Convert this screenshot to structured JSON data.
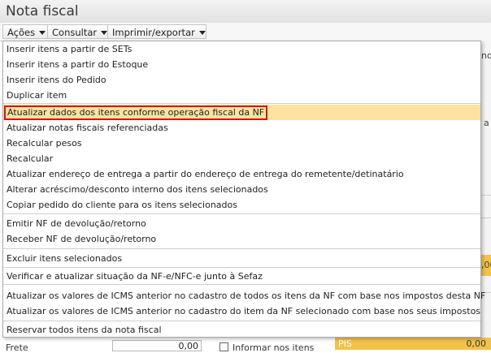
{
  "window": {
    "title": "Nota fiscal"
  },
  "toolbar": {
    "acoes": "Ações",
    "consultar": "Consultar",
    "imprimir": "Imprimir/exportar"
  },
  "menu": {
    "items": [
      "Inserir itens a partir de SETs",
      "Inserir itens a partir do Estoque",
      "Inserir itens do Pedido",
      "Duplicar item",
      "Atualizar dados dos itens conforme operação fiscal da NF",
      "Atualizar notas fiscais referenciadas",
      "Recalcular pesos",
      "Recalcular",
      "Atualizar endereço de entrega a partir do endereço de entrega do remetente/detinatário",
      "Alterar acréscimo/desconto interno dos itens selecionados",
      "Copiar pedido do cliente para os itens selecionados",
      "Emitir NF de devolução/retorno",
      "Receber NF de devolução/retorno",
      "Excluir itens selecionados",
      "Verificar e atualizar situação da NF-e/NFC-e junto à Sefaz",
      "Atualizar os valores de ICMS anterior no cadastro de todos os itens da NF com base nos impostos desta NF",
      "Atualizar os valores de ICMS anterior no cadastro do item da NF selecionado com base nos seus impostos",
      "Reservar todos itens da nota fiscal"
    ],
    "highlighted_index": 4
  },
  "background": {
    "frag_no": "no",
    "frag_a": "a",
    "frag_00": ",00",
    "frete_label": "Frete",
    "frete_value": "0,00",
    "informar_label": "Informar nos itens",
    "pis_label": "PIS",
    "pis_value": "0,00"
  },
  "colors": {
    "highlight_bg": "#fbe3a0",
    "highlight_border": "#e01010",
    "yellow_cell": "#f2c24a"
  }
}
